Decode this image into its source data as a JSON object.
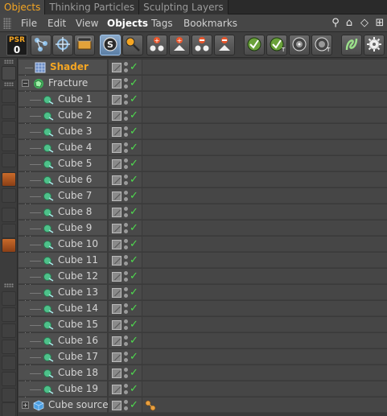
{
  "tabs": [
    {
      "label": "Objects",
      "active": true
    },
    {
      "label": "Thinking Particles",
      "active": false
    },
    {
      "label": "Sculpting Layers",
      "active": false
    }
  ],
  "menu": [
    {
      "label": "File",
      "active": false
    },
    {
      "label": "Edit",
      "active": false
    },
    {
      "label": "View",
      "active": false
    },
    {
      "label": "Objects",
      "active": true
    },
    {
      "label": "Tags",
      "active": false
    },
    {
      "label": "Bookmarks",
      "active": false
    }
  ],
  "menu_icons": [
    "search-icon",
    "home-icon",
    "eye-icon",
    "new-window-icon"
  ],
  "toolbar": {
    "psr_label": "PSR",
    "psr_value": "0",
    "buttons": [
      "hierarchy-icon",
      "move-icon",
      "render-icon",
      "solo-icon",
      "find-icon",
      "add-object-icon",
      "add-hierarchy-icon",
      "remove-object-icon",
      "remove-hierarchy-icon",
      "check-icon",
      "check-tag-icon",
      "target-icon",
      "target-tag-icon",
      "spline-icon",
      "gear-icon"
    ]
  },
  "tree": {
    "rows": [
      {
        "name": "Shader",
        "type": "shader",
        "depth": 1,
        "tag": false
      },
      {
        "name": "Fracture",
        "type": "fracture",
        "depth": 0,
        "expanded": true,
        "tag": false
      },
      {
        "name": "Cube 1",
        "type": "cube",
        "depth": 2,
        "tag": false
      },
      {
        "name": "Cube 2",
        "type": "cube",
        "depth": 2,
        "tag": false
      },
      {
        "name": "Cube 3",
        "type": "cube",
        "depth": 2,
        "tag": false
      },
      {
        "name": "Cube 4",
        "type": "cube",
        "depth": 2,
        "tag": false
      },
      {
        "name": "Cube 5",
        "type": "cube",
        "depth": 2,
        "tag": false
      },
      {
        "name": "Cube 6",
        "type": "cube",
        "depth": 2,
        "tag": false
      },
      {
        "name": "Cube 7",
        "type": "cube",
        "depth": 2,
        "tag": false
      },
      {
        "name": "Cube 8",
        "type": "cube",
        "depth": 2,
        "tag": false
      },
      {
        "name": "Cube 9",
        "type": "cube",
        "depth": 2,
        "tag": false
      },
      {
        "name": "Cube 10",
        "type": "cube",
        "depth": 2,
        "tag": false
      },
      {
        "name": "Cube 11",
        "type": "cube",
        "depth": 2,
        "tag": false
      },
      {
        "name": "Cube 12",
        "type": "cube",
        "depth": 2,
        "tag": false
      },
      {
        "name": "Cube 13",
        "type": "cube",
        "depth": 2,
        "tag": false
      },
      {
        "name": "Cube 14",
        "type": "cube",
        "depth": 2,
        "tag": false
      },
      {
        "name": "Cube 15",
        "type": "cube",
        "depth": 2,
        "tag": false
      },
      {
        "name": "Cube 16",
        "type": "cube",
        "depth": 2,
        "tag": false
      },
      {
        "name": "Cube 17",
        "type": "cube",
        "depth": 2,
        "tag": false
      },
      {
        "name": "Cube 18",
        "type": "cube",
        "depth": 2,
        "tag": false
      },
      {
        "name": "Cube 19",
        "type": "cube",
        "depth": 2,
        "tag": false
      },
      {
        "name": "Cube source",
        "type": "cube-source",
        "depth": 0,
        "expanded": false,
        "tag": true
      }
    ]
  },
  "colors": {
    "accent": "#f5a623",
    "check": "#4fdc4f",
    "background": "#3a3a3a"
  }
}
